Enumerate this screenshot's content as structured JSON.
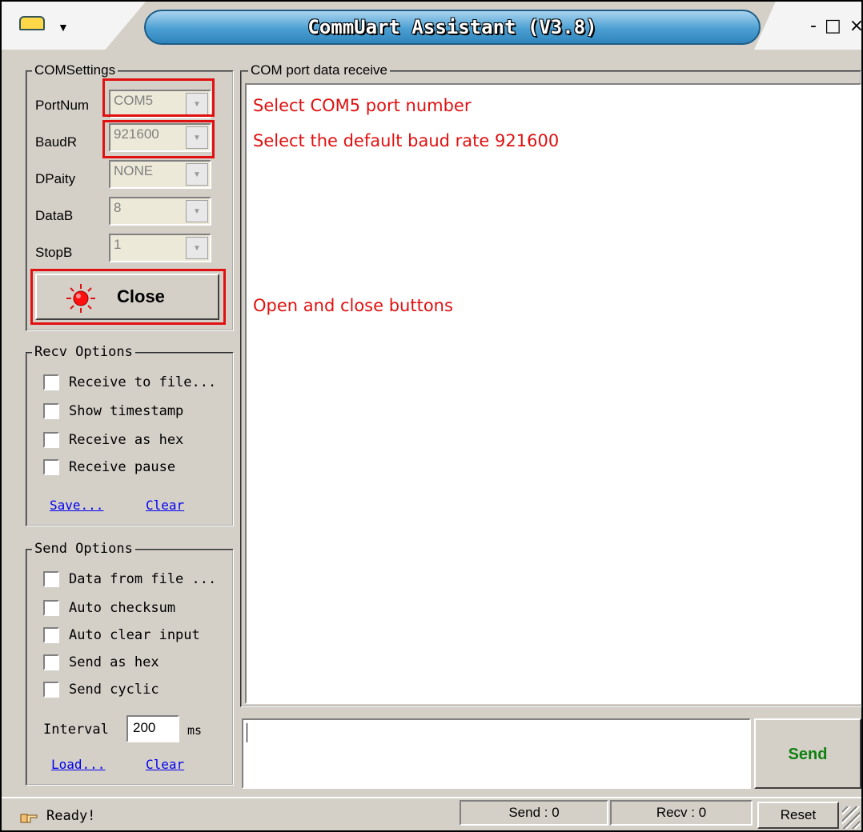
{
  "window": {
    "title": "CommUart Assistant (V3.8)"
  },
  "com_settings": {
    "legend": "COMSettings",
    "fields": [
      {
        "label": "PortNum",
        "value": "COM5"
      },
      {
        "label": "BaudR",
        "value": "921600"
      },
      {
        "label": "DPaity",
        "value": "NONE"
      },
      {
        "label": "DataB",
        "value": "8"
      },
      {
        "label": "StopB",
        "value": "1"
      }
    ],
    "close_label": "Close"
  },
  "receive_area": {
    "legend": "COM port data receive"
  },
  "annotations": {
    "port": "Select COM5 port number",
    "baud": "Select the default baud rate 921600",
    "buttons": "Open and close buttons",
    "color": "#e01010"
  },
  "recv_options": {
    "legend": "Recv Options",
    "items": [
      "Receive to file...",
      "Show timestamp",
      "Receive as hex",
      "Receive pause"
    ],
    "save_link": "Save...",
    "clear_link": "Clear"
  },
  "send_options": {
    "legend": "Send Options",
    "items": [
      "Data from file ...",
      "Auto checksum",
      "Auto clear input",
      "Send as hex",
      "Send cyclic"
    ],
    "interval_label": "Interval",
    "interval_value": "200",
    "interval_unit": "ms",
    "load_link": "Load...",
    "clear_link": "Clear"
  },
  "send_button": {
    "label": "Send",
    "color": "#108010"
  },
  "status_bar": {
    "status": "Ready!",
    "send_count": "Send : 0",
    "recv_count": "Recv : 0",
    "reset_label": "Reset"
  }
}
